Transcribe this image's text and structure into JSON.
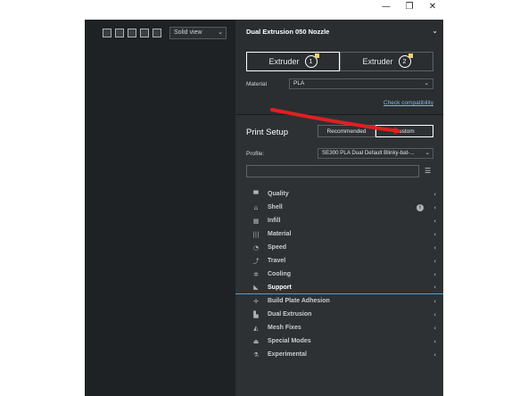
{
  "window": {
    "minimize": "—",
    "maximize": "❐",
    "close": "✕"
  },
  "viewport": {
    "view_icons": [
      "view-3d-icon",
      "view-front-icon",
      "view-top-icon",
      "view-left-icon",
      "view-right-icon"
    ],
    "view_mode": "Solid view"
  },
  "printer": {
    "title": "Dual Extrusion 050 Nozzle"
  },
  "extruders": [
    {
      "label": "Extruder",
      "number": "1"
    },
    {
      "label": "Extruder",
      "number": "2"
    }
  ],
  "material": {
    "label": "Material",
    "value": "PLA",
    "check_link": "Check compatibility"
  },
  "print_setup": {
    "title": "Print Setup",
    "modes": [
      "Recommended",
      "Custom"
    ],
    "active_mode": "Custom",
    "profile_label": "Profile:",
    "profile_value": "SE300 PLA Dual Default Blinky-bat-..."
  },
  "categories": [
    {
      "label": "Quality",
      "icon": "▀"
    },
    {
      "label": "Shell",
      "icon": "⌂"
    },
    {
      "label": "Infill",
      "icon": "▦"
    },
    {
      "label": "Material",
      "icon": "|||"
    },
    {
      "label": "Speed",
      "icon": "◔"
    },
    {
      "label": "Travel",
      "icon": "⤴"
    },
    {
      "label": "Cooling",
      "icon": "✲"
    },
    {
      "label": "Support",
      "icon": "◣"
    },
    {
      "label": "Build Plate Adhesion",
      "icon": "✛"
    },
    {
      "label": "Dual Extrusion",
      "icon": "▙"
    },
    {
      "label": "Mesh Fixes",
      "icon": "◭"
    },
    {
      "label": "Special Modes",
      "icon": "⏏"
    },
    {
      "label": "Experimental",
      "icon": "⚗"
    }
  ],
  "colors": {
    "accent": "#4aa3d9",
    "arrow": "#e02020"
  }
}
